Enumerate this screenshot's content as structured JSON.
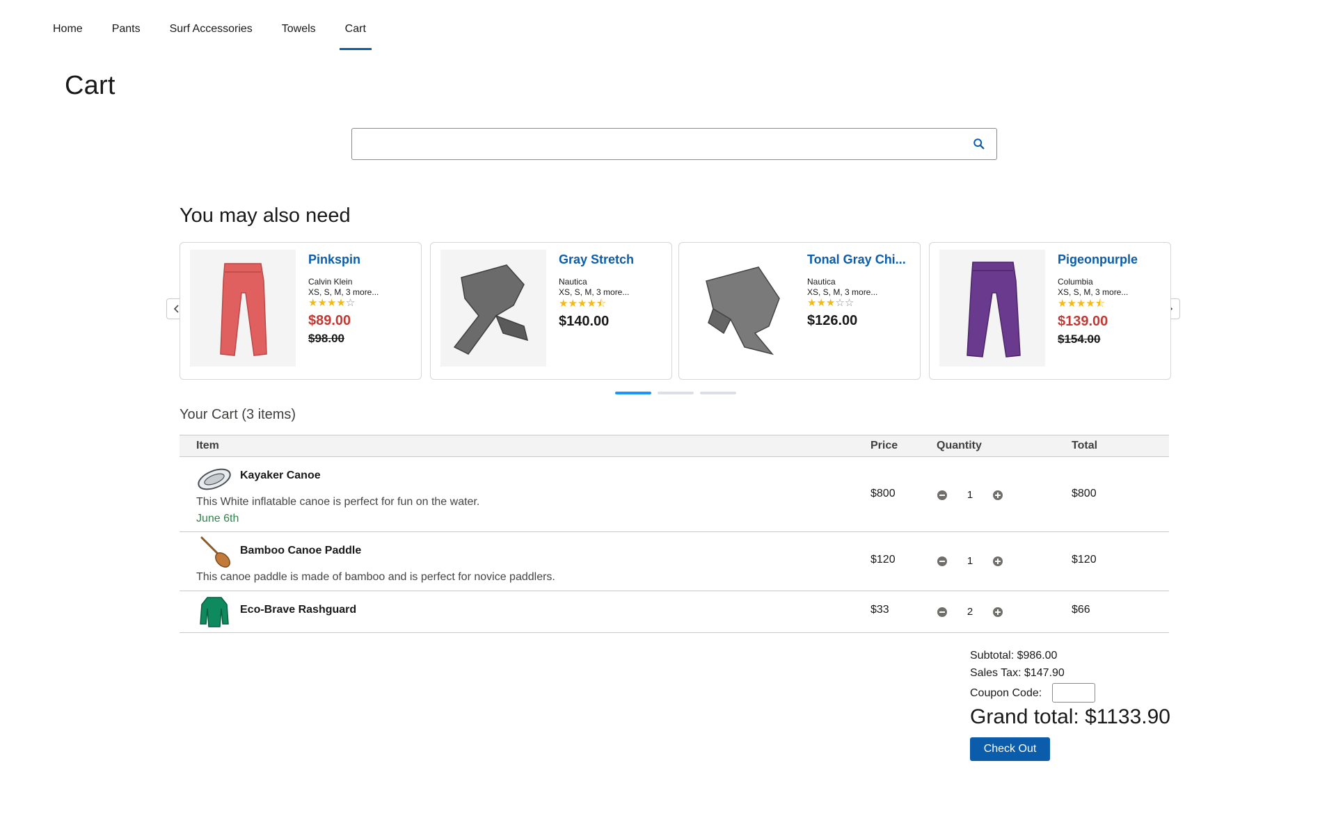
{
  "nav": {
    "items": [
      {
        "label": "Home"
      },
      {
        "label": "Pants"
      },
      {
        "label": "Surf Accessories"
      },
      {
        "label": "Towels"
      },
      {
        "label": "Cart"
      }
    ],
    "active": "Cart"
  },
  "page": {
    "title": "Cart"
  },
  "search": {
    "value": "",
    "placeholder": ""
  },
  "recommendations": {
    "title": "You may also need",
    "products": [
      {
        "name": "Pinkspin",
        "brand": "Calvin Klein",
        "sizes": "XS, S, M, 3 more...",
        "rating": 4,
        "price": "$89.00",
        "original_price": "$98.00",
        "on_sale": true,
        "color": "#e0605f"
      },
      {
        "name": "Gray Stretch",
        "brand": "Nautica",
        "sizes": "XS, S, M, 3 more...",
        "rating": 4.5,
        "price": "$140.00",
        "original_price": "",
        "on_sale": false,
        "color": "#6b6b6b"
      },
      {
        "name": "Tonal Gray Chi...",
        "brand": "Nautica",
        "sizes": "XS, S, M, 3 more...",
        "rating": 3,
        "price": "$126.00",
        "original_price": "",
        "on_sale": false,
        "color": "#7a7a7a"
      },
      {
        "name": "Pigeonpurple",
        "brand": "Columbia",
        "sizes": "XS, S, M, 3 more...",
        "rating": 4.5,
        "price": "$139.00",
        "original_price": "$154.00",
        "on_sale": true,
        "color": "#6a3a8e"
      }
    ],
    "page_count": 3,
    "active_page": 1
  },
  "cart": {
    "title": "Your Cart (3 items)",
    "headers": {
      "item": "Item",
      "price": "Price",
      "quantity": "Quantity",
      "total": "Total"
    },
    "items": [
      {
        "name": "Kayaker Canoe",
        "description": "This White inflatable canoe is perfect for fun on the water.",
        "date": "June 6th",
        "price": "$800",
        "quantity": "1",
        "total": "$800"
      },
      {
        "name": "Bamboo Canoe Paddle",
        "description": "This canoe paddle is made of bamboo and is perfect for novice paddlers.",
        "date": "",
        "price": "$120",
        "quantity": "1",
        "total": "$120"
      },
      {
        "name": "Eco-Brave Rashguard",
        "description": "",
        "date": "",
        "price": "$33",
        "quantity": "2",
        "total": "$66"
      }
    ]
  },
  "summary": {
    "subtotal": "Subtotal: $986.00",
    "sales_tax": "Sales Tax: $147.90",
    "coupon_label": "Coupon Code:",
    "coupon_value": "",
    "grand_total": "Grand total: $1133.90",
    "checkout_label": "Check Out"
  },
  "colors": {
    "brand": "#0b5cab",
    "sale": "#c23934",
    "star": "#f5b914",
    "date": "#2e844a",
    "dot_active": "#1b96ff"
  }
}
